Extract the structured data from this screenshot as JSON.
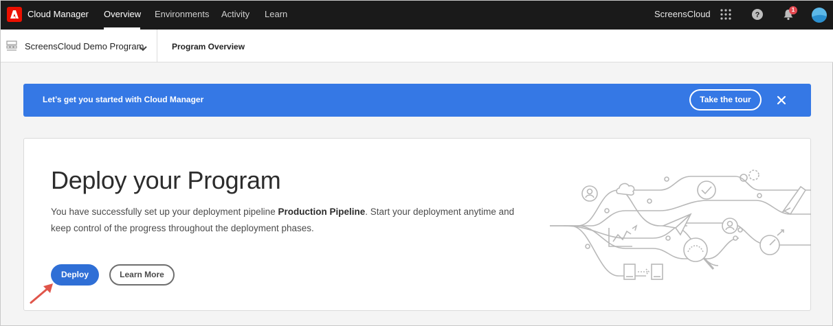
{
  "topbar": {
    "app_title": "Cloud Manager",
    "nav": [
      {
        "label": "Overview",
        "active": true
      },
      {
        "label": "Environments",
        "active": false
      },
      {
        "label": "Activity",
        "active": false
      },
      {
        "label": "Learn",
        "active": false
      }
    ],
    "org_name": "ScreensCloud",
    "notification_count": "1"
  },
  "subheader": {
    "program_name": "ScreensCloud Demo Program",
    "page_title": "Program Overview"
  },
  "banner": {
    "text": "Let’s get you started with Cloud Manager",
    "tour_label": "Take the tour"
  },
  "card": {
    "title": "Deploy your Program",
    "desc_before": "You have successfully set up your deployment pipeline ",
    "pipeline_name": "Production Pipeline",
    "desc_after": ". Start your deployment anytime and keep control of the progress throughout the deployment phases.",
    "deploy_label": "Deploy",
    "learn_label": "Learn More"
  },
  "colors": {
    "brand_red": "#eb1000",
    "banner_blue": "#3578e5",
    "button_blue": "#2f6fd6",
    "topbar": "#1a1a1a"
  }
}
